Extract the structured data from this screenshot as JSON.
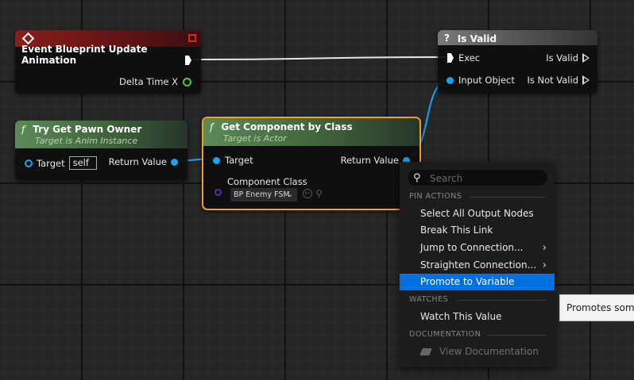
{
  "nodes": {
    "event_update": {
      "title": "Event Blueprint Update Animation",
      "pin_delta": "Delta Time X"
    },
    "is_valid": {
      "title": "Is Valid",
      "pin_exec": "Exec",
      "pin_input": "Input Object",
      "pin_is_valid": "Is Valid",
      "pin_is_not_valid": "Is Not Valid"
    },
    "try_get_pawn": {
      "title": "Try Get Pawn Owner",
      "subtitle": "Target is Anim Instance",
      "pin_target": "Target",
      "target_value": "self",
      "pin_return": "Return Value"
    },
    "get_component": {
      "title": "Get Component by Class",
      "subtitle": "Target is Actor",
      "pin_target": "Target",
      "pin_return": "Return Value",
      "pin_class": "Component Class",
      "class_value": "BP Enemy FSM"
    }
  },
  "context_menu": {
    "search_placeholder": "Search",
    "sections": {
      "pin_actions": "PIN ACTIONS",
      "watches": "WATCHES",
      "documentation": "DOCUMENTATION"
    },
    "items": {
      "select_all": "Select All Output Nodes",
      "break_link": "Break This Link",
      "jump": "Jump to Connection...",
      "straighten": "Straighten Connection...",
      "promote": "Promote to Variable",
      "watch": "Watch This Value",
      "view_doc": "View Documentation"
    }
  },
  "tooltip": {
    "text": "Promotes something to a variable"
  },
  "colors": {
    "event_header": "#8a1d1d",
    "function_header": "#4f7a4a",
    "is_valid_header": "#6e6e6e",
    "object_pin": "#1aa4f0",
    "float_pin": "#58c837",
    "class_pin": "#5a2aa8",
    "selection_outline": "#f0a020",
    "menu_highlight": "#0070e0"
  }
}
